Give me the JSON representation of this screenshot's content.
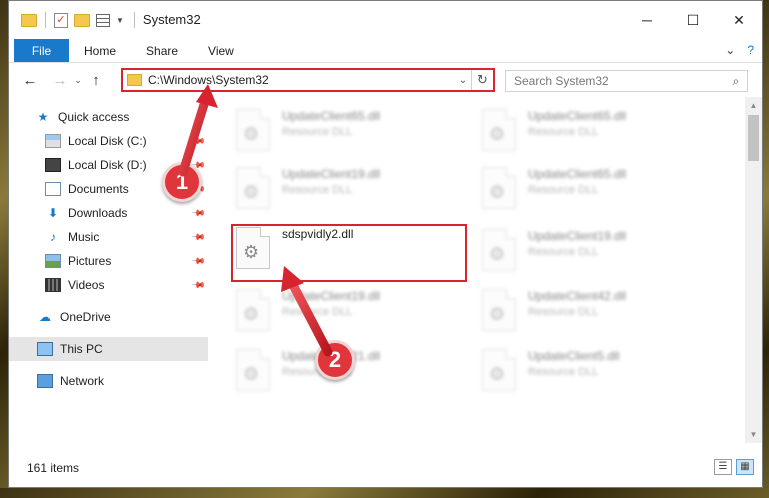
{
  "window": {
    "title": "System32",
    "minimize_glyph": "─",
    "maximize_glyph": "☐",
    "close_glyph": "✕"
  },
  "ribbon": {
    "tabs": [
      "File",
      "Home",
      "Share",
      "View"
    ],
    "expand_glyph": "⌄",
    "help_glyph": "?"
  },
  "navigation": {
    "back_glyph": "←",
    "forward_glyph": "→",
    "recent_glyph": "⌄",
    "up_glyph": "↑",
    "address": "C:\\Windows\\System32",
    "address_drop_glyph": "⌄",
    "refresh_glyph": "↻",
    "search_placeholder": "Search System32",
    "search_glyph": "⌕"
  },
  "sidebar": {
    "items": [
      {
        "label": "Quick access",
        "icon": "star-icon"
      },
      {
        "label": "Local Disk (C:)",
        "icon": "drive-icon",
        "pinned": true
      },
      {
        "label": "Local Disk (D:)",
        "icon": "drive-icon",
        "pinned": true
      },
      {
        "label": "Documents",
        "icon": "document-icon",
        "pinned": true
      },
      {
        "label": "Downloads",
        "icon": "download-icon",
        "pinned": true
      },
      {
        "label": "Music",
        "icon": "music-icon",
        "pinned": true
      },
      {
        "label": "Pictures",
        "icon": "picture-icon",
        "pinned": true
      },
      {
        "label": "Videos",
        "icon": "video-icon",
        "pinned": true
      },
      {
        "label": "OneDrive",
        "icon": "cloud-icon"
      },
      {
        "label": "This PC",
        "icon": "computer-icon",
        "selected": true
      },
      {
        "label": "Network",
        "icon": "network-icon"
      }
    ]
  },
  "files": [
    {
      "name": "UpdateClient65.dll",
      "type": "Resource DLL"
    },
    {
      "name": "UpdateClient65.dll",
      "type": "Resource DLL"
    },
    {
      "name": "UpdateClient19.dll",
      "type": "Resource DLL"
    },
    {
      "name": "UpdateClient65.dll",
      "type": "Resource DLL"
    },
    {
      "name": "sdspvidly2.dll",
      "type": ""
    },
    {
      "name": "UpdateClient19.dll",
      "type": "Resource DLL"
    },
    {
      "name": "UpdateClient19.dll",
      "type": "Resource DLL"
    },
    {
      "name": "UpdateClient42.dll",
      "type": "Resource DLL"
    },
    {
      "name": "UpdateClient21.dll",
      "type": "Resource DLL"
    },
    {
      "name": "UpdateClient5.dll",
      "type": "Resource DLL"
    }
  ],
  "status": {
    "item_count": "161 items",
    "details_view_glyph": "☰",
    "tiles_view_glyph": "▦"
  },
  "annotations": {
    "step1": "1",
    "step2": "2",
    "color": "#d7242f"
  }
}
